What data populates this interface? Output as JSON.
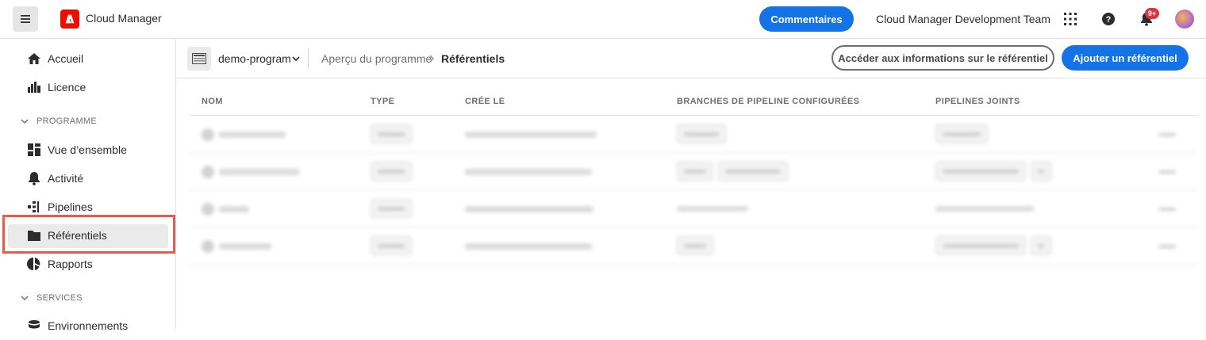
{
  "header": {
    "brand": "Cloud Manager",
    "feedback_label": "Commentaires",
    "org_name": "Cloud Manager Development Team",
    "notification_count": "9+",
    "colors": {
      "accent": "#1473e6",
      "brand": "#eb1000",
      "badge": "#d7373f"
    }
  },
  "sidebar": {
    "items": [
      {
        "label": "Accueil",
        "icon": "home-icon"
      },
      {
        "label": "Licence",
        "icon": "license-icon"
      }
    ],
    "section_program": "PROGRAMME",
    "program_items": [
      {
        "label": "Vue d’ensemble",
        "icon": "overview-icon"
      },
      {
        "label": "Activité",
        "icon": "bell-icon"
      },
      {
        "label": "Pipelines",
        "icon": "pipeline-icon"
      },
      {
        "label": "Référentiels",
        "icon": "folder-icon",
        "active": true
      },
      {
        "label": "Rapports",
        "icon": "pie-chart-icon"
      }
    ],
    "section_services": "SERVICES",
    "service_items": [
      {
        "label": "Environnements",
        "icon": "database-icon"
      }
    ]
  },
  "subheader": {
    "program": "demo-program",
    "breadcrumb_parent": "Aperçu du programme",
    "breadcrumb_current": "Référentiels",
    "info_button": "Accéder aux informations sur le référentiel",
    "add_button": "Ajouter un référentiel"
  },
  "table": {
    "columns": [
      "NOM",
      "TYPE",
      "CRÉE LE",
      "BRANCHES DE PIPELINE CONFIGURÉES",
      "PIPELINES JOINTS"
    ]
  }
}
